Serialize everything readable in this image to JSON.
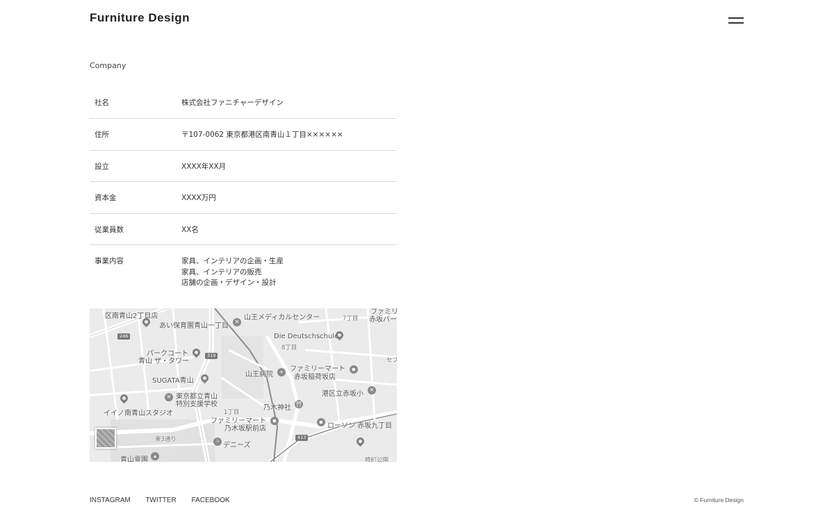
{
  "header": {
    "site_title": "Furniture Design",
    "menu_icon": "hamburger-icon"
  },
  "company": {
    "section_title": "Company",
    "rows": [
      {
        "label": "社名",
        "value": [
          "株式会社ファニチャーデザイン"
        ]
      },
      {
        "label": "住所",
        "value": [
          "〒107-0062 東京都港区南青山１丁目××××××"
        ]
      },
      {
        "label": "設立",
        "value": [
          "XXXX年XX月"
        ]
      },
      {
        "label": "資本金",
        "value": [
          "XXXX万円"
        ]
      },
      {
        "label": "従業員数",
        "value": [
          "XX名"
        ]
      },
      {
        "label": "事業内容",
        "value": [
          "家具、インテリアの企画・生産",
          "家具、インテリアの販売",
          "店舗の企画・デザイン・設計"
        ]
      }
    ]
  },
  "map": {
    "labels": [
      "区南青山2丁目店",
      "あい保育園青山一丁目",
      "山王メディカルセンター",
      "7丁目",
      "ファミリ",
      "赤坂バー",
      "Die Deutschschule",
      "8丁目",
      "パークコート",
      "青山 ザ・タワー",
      "ファミリーマート",
      "赤坂稲荷坂店",
      "セブ",
      "SUGATA青山",
      "山王病院",
      "港区立赤坂小",
      "東京都立青山",
      "特別支援学校",
      "乃木神社",
      "イイノ南青山スタジオ",
      "1丁目",
      "ファミリーマート",
      "乃木坂駅前店",
      "ローソン 赤坂九丁目",
      "デニーズ",
      "青山霊園",
      "檜町公園",
      "東3通り"
    ],
    "route_numbers": [
      "246",
      "319",
      "413"
    ]
  },
  "footer": {
    "links": [
      "INSTAGRAM",
      "TWITTER",
      "FACEBOOK"
    ],
    "copyright": "© Furniture Design"
  }
}
